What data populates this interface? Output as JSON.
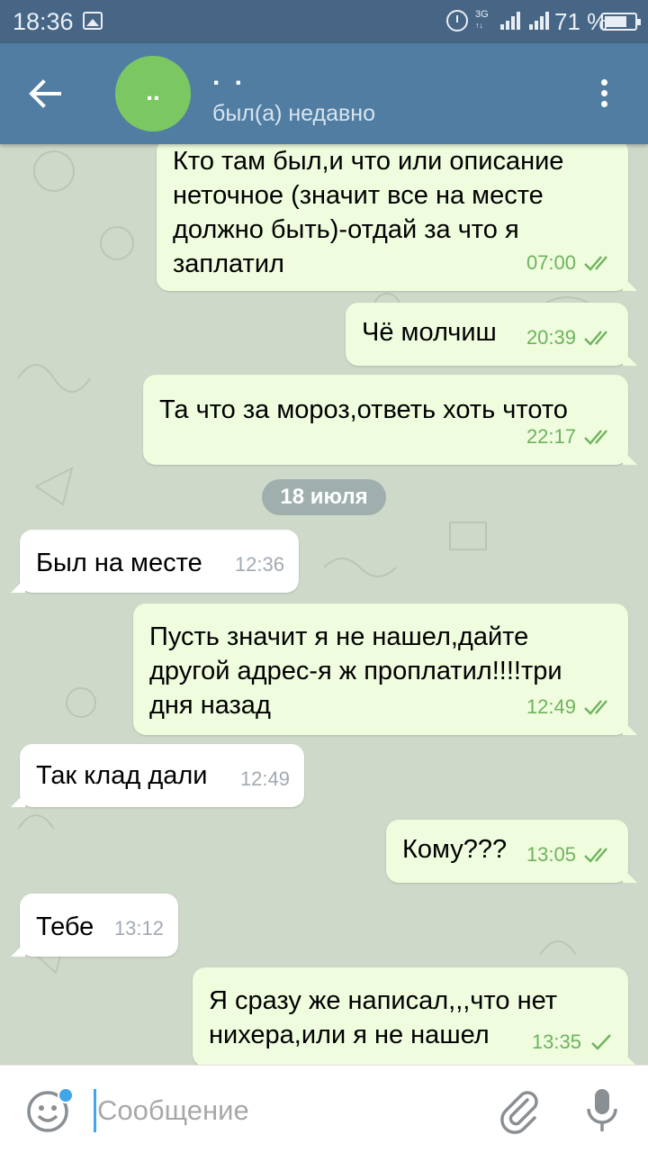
{
  "status_bar": {
    "time": "18:36",
    "network_top": "3G",
    "network_bottom": "↑↓",
    "battery": "71 %"
  },
  "header": {
    "chat_name": ". .",
    "avatar_initials": "..",
    "status": "был(а) недавно",
    "avatar_color": "#7bc862",
    "bar_color": "#517da2"
  },
  "date_separator": "18 июля",
  "messages": [
    {
      "side": "out",
      "lines": [
        "Кто там был,и что или описание",
        "неточное (значит все на месте",
        "должно быть)-отдай за что я",
        "заплатил"
      ],
      "time": "07:00",
      "status": "read"
    },
    {
      "side": "out",
      "lines": [
        "Чё молчиш"
      ],
      "time": "20:39",
      "status": "read"
    },
    {
      "side": "out",
      "lines": [
        "Та что за мороз,ответь хоть чтото"
      ],
      "time": "22:17",
      "status": "read"
    },
    {
      "side": "in",
      "lines": [
        "Был на месте"
      ],
      "time": "12:36"
    },
    {
      "side": "out",
      "lines": [
        "Пусть значит я не нашел,дайте",
        "другой адрес-я ж проплатил!!!!три",
        "дня назад"
      ],
      "time": "12:49",
      "status": "read"
    },
    {
      "side": "in",
      "lines": [
        "Так клад дали"
      ],
      "time": "12:49"
    },
    {
      "side": "out",
      "lines": [
        "Кому???"
      ],
      "time": "13:05",
      "status": "read"
    },
    {
      "side": "in",
      "lines": [
        "Тебе"
      ],
      "time": "13:12"
    },
    {
      "side": "out",
      "lines": [
        "Я сразу же написал,,,что нет",
        "нихера,или я не нашел"
      ],
      "time": "13:35",
      "status": "sent"
    }
  ],
  "composer": {
    "placeholder": "Сообщение",
    "value": ""
  },
  "icons": {
    "back": "arrow-left-icon",
    "menu": "more-vertical-icon",
    "emoji": "emoji-icon",
    "attach": "paperclip-icon",
    "mic": "microphone-icon"
  },
  "colors": {
    "outgoing_bubble": "#effdde",
    "incoming_bubble": "#ffffff",
    "read_tick": "#6fb25d",
    "accent": "#3fa6ec"
  }
}
